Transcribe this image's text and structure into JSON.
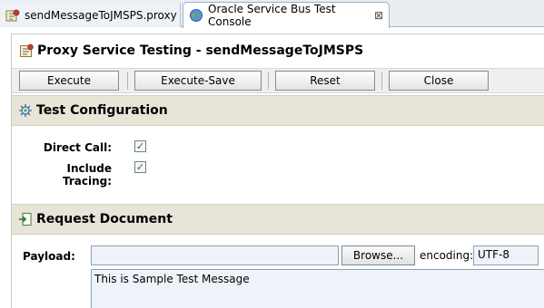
{
  "tabs": [
    {
      "label": "sendMessageToJMSPS.proxy",
      "icon": "proxy-file-icon"
    },
    {
      "label": "Oracle Service Bus Test Console",
      "icon": "globe-icon",
      "active": true
    }
  ],
  "page": {
    "title": "Proxy Service Testing - sendMessageToJMSPS"
  },
  "toolbar": {
    "execute": "Execute",
    "execute_save": "Execute-Save",
    "reset": "Reset",
    "close": "Close"
  },
  "test_config": {
    "title": "Test Configuration",
    "direct_call": {
      "label": "Direct Call:",
      "checked": true
    },
    "include_tracing": {
      "label": "Include Tracing:",
      "checked": true
    }
  },
  "request": {
    "title": "Request Document",
    "payload_label": "Payload:",
    "file_value": "",
    "browse_label": "Browse...",
    "encoding_label": "encoding:",
    "encoding_value": "UTF-8",
    "payload_text": "This is Sample Test Message"
  },
  "colors": {
    "section_bg": "#e8e4d8",
    "input_bg": "#eef3fa",
    "check_color": "#3a6b2a"
  }
}
